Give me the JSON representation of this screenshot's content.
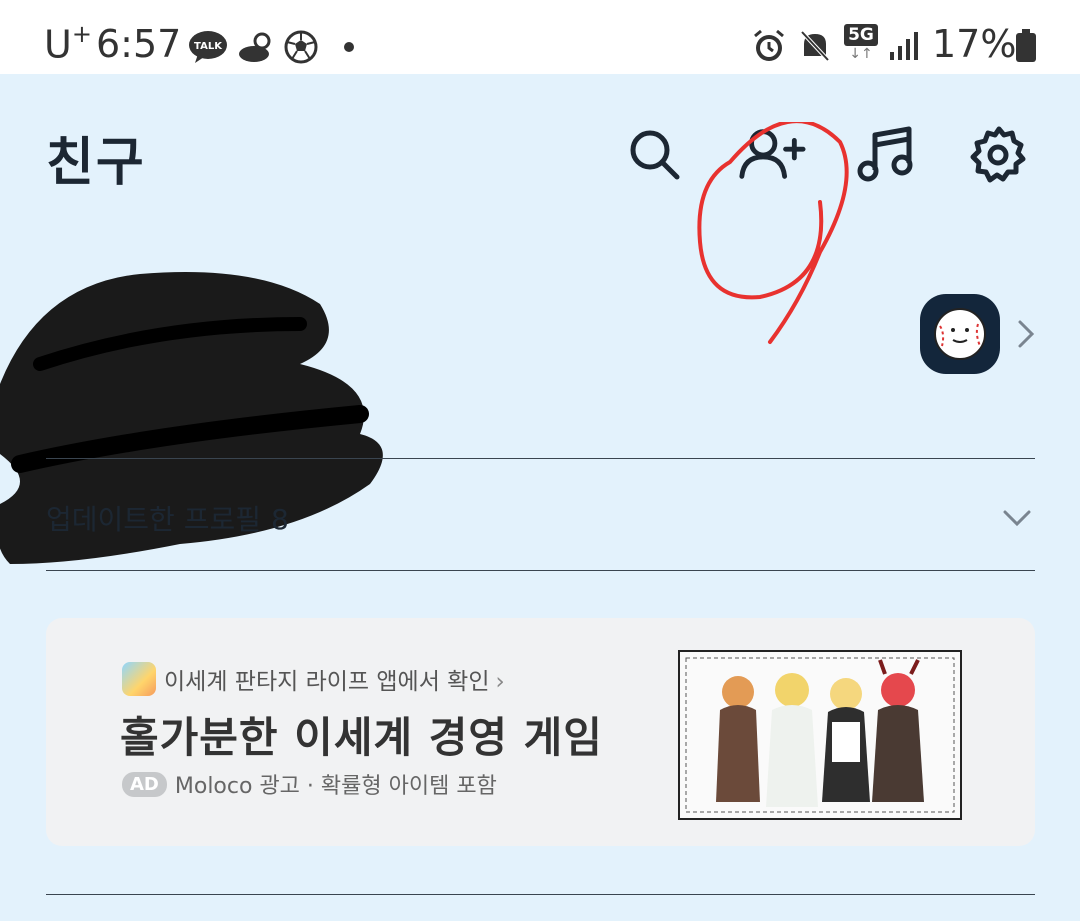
{
  "status_bar": {
    "carrier": "U",
    "carrier_sup": "+",
    "time": "6:57",
    "network": "5G",
    "battery": "17%",
    "icons": [
      "kakaotalk-icon",
      "weather-icon",
      "soccer-ball-icon",
      "dot-icon",
      "alarm-icon",
      "mute-icon",
      "signal-icon",
      "battery-icon"
    ],
    "talk_icon_text": "TALK"
  },
  "header": {
    "title": "친구",
    "actions": [
      "search-icon",
      "add-friend-icon",
      "music-icon",
      "settings-icon"
    ]
  },
  "updated_profiles": {
    "label": "업데이트한 프로필",
    "count": "8"
  },
  "ad": {
    "app_line": "이세계 판타지 라이프 앱에서 확인",
    "app_chevron": "›",
    "headline": "홀가분한 이세계 경영 게임",
    "badge": "AD",
    "meta": "Moloco 광고 · 확률형 아이템 포함"
  },
  "colors": {
    "screen_bg": "#e3f2fc",
    "accent_dark": "#13263b",
    "annotation_red": "#e8322f"
  }
}
